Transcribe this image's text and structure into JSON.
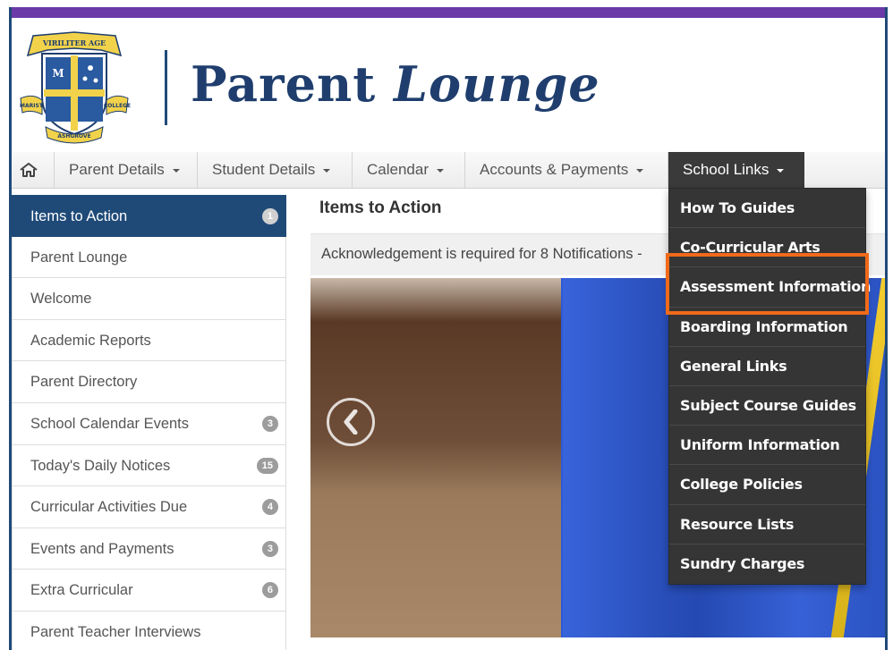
{
  "header": {
    "title_part1": "Parent",
    "title_part2": "Lounge",
    "crest_motto": "VIRILITER AGE",
    "crest_banner_left": "MARIST",
    "crest_banner_right": "COLLEGE",
    "crest_banner_bottom": "ASHGROVE",
    "colors": {
      "purple_bar": "#6a3aa8",
      "navy": "#1f4a78"
    }
  },
  "nav": {
    "home_icon": "home-icon",
    "items": [
      {
        "label": "Parent Details"
      },
      {
        "label": "Student Details"
      },
      {
        "label": "Calendar"
      },
      {
        "label": "Accounts & Payments"
      },
      {
        "label": "School Links"
      }
    ]
  },
  "sidebar": {
    "items": [
      {
        "label": "Items to Action",
        "badge": "1"
      },
      {
        "label": "Parent Lounge",
        "badge": ""
      },
      {
        "label": "Welcome",
        "badge": ""
      },
      {
        "label": "Academic Reports",
        "badge": ""
      },
      {
        "label": "Parent Directory",
        "badge": ""
      },
      {
        "label": "School Calendar Events",
        "badge": "3"
      },
      {
        "label": "Today's Daily Notices",
        "badge": "15"
      },
      {
        "label": "Curricular Activities Due",
        "badge": "4"
      },
      {
        "label": "Events and Payments",
        "badge": "3"
      },
      {
        "label": "Extra Curricular",
        "badge": "6"
      },
      {
        "label": "Parent Teacher Interviews",
        "badge": ""
      }
    ]
  },
  "main": {
    "title": "Items to Action",
    "notice": "Acknowledgement is required for 8 Notifications -"
  },
  "dropdown": {
    "items": [
      {
        "label": "How To Guides"
      },
      {
        "label": "Co-Curricular Arts"
      },
      {
        "label": "Assessment Information"
      },
      {
        "label": "Boarding Information"
      },
      {
        "label": "General Links"
      },
      {
        "label": "Subject Course Guides"
      },
      {
        "label": "Uniform Information"
      },
      {
        "label": "College Policies"
      },
      {
        "label": "Resource Lists"
      },
      {
        "label": "Sundry Charges"
      }
    ],
    "highlight_color": "#f06a1a"
  }
}
